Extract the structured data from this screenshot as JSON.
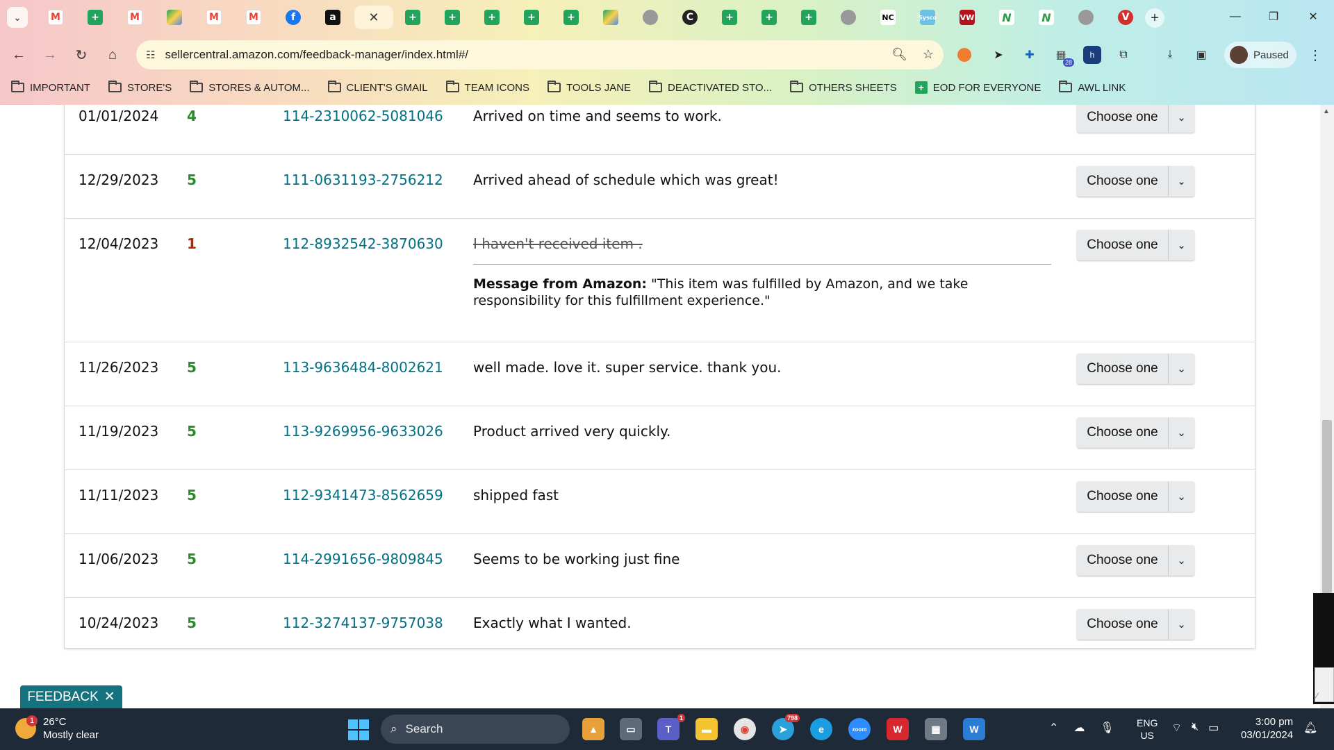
{
  "browser": {
    "url": "sellercentral.amazon.com/feedback-manager/index.html#/",
    "profile_label": "Paused",
    "bookmarks": [
      {
        "label": "IMPORTANT",
        "type": "folder"
      },
      {
        "label": "STORE'S",
        "type": "folder"
      },
      {
        "label": "STORES & AUTOM...",
        "type": "folder"
      },
      {
        "label": "CLIENT'S GMAIL",
        "type": "folder"
      },
      {
        "label": "TEAM ICONS",
        "type": "folder"
      },
      {
        "label": "TOOLS JANE",
        "type": "folder"
      },
      {
        "label": "DEACTIVATED STO...",
        "type": "folder"
      },
      {
        "label": "OTHERS SHEETS",
        "type": "folder"
      },
      {
        "label": "EOD FOR EVERYONE",
        "type": "sheet"
      },
      {
        "label": "AWL LINK",
        "type": "folder"
      }
    ],
    "tab_icons": [
      "gmail",
      "sheets",
      "gmail",
      "drive",
      "gmail",
      "gmail",
      "facebook",
      "amazon",
      "active-close",
      "sheets",
      "sheets",
      "sheets",
      "sheets",
      "sheets",
      "tool",
      "generic",
      "dark-c",
      "sheets",
      "sheets",
      "sheets",
      "cloud",
      "nc",
      "sysco",
      "vw",
      "n",
      "n",
      "circle",
      "red-v"
    ],
    "extension_badge": "28"
  },
  "feedback": {
    "rows": [
      {
        "date": "01/01/2024",
        "rating": "4",
        "order": "114-2310062-5081046",
        "comment": "Arrived on time and seems to work.",
        "action": "Choose one"
      },
      {
        "date": "12/29/2023",
        "rating": "5",
        "order": "111-0631193-2756212",
        "comment": "Arrived ahead of schedule which was great!",
        "action": "Choose one"
      },
      {
        "date": "12/04/2023",
        "rating": "1",
        "order": "112-8932542-3870630",
        "comment": "I haven't received item .",
        "struck": true,
        "amazon_label": "Message from Amazon:",
        "amazon_message": "\"This item was fulfilled by Amazon, and we take responsibility for this fulfillment experience.\"",
        "action": "Choose one"
      },
      {
        "date": "11/26/2023",
        "rating": "5",
        "order": "113-9636484-8002621",
        "comment": "well made. love it. super service. thank you.",
        "action": "Choose one"
      },
      {
        "date": "11/19/2023",
        "rating": "5",
        "order": "113-9269956-9633026",
        "comment": "Product arrived very quickly.",
        "action": "Choose one"
      },
      {
        "date": "11/11/2023",
        "rating": "5",
        "order": "112-9341473-8562659",
        "comment": "shipped fast",
        "action": "Choose one"
      },
      {
        "date": "11/06/2023",
        "rating": "5",
        "order": "114-2991656-9809845",
        "comment": "Seems to be working just fine",
        "action": "Choose one"
      },
      {
        "date": "10/24/2023",
        "rating": "5",
        "order": "112-3274137-9757038",
        "comment": "Exactly what I wanted.",
        "action": "Choose one"
      }
    ],
    "feedback_tab_label": "FEEDBACK",
    "colors": {
      "link": "#007185",
      "positive": "#2a8a2a",
      "negative": "#b12704",
      "feedback_tab": "#14737f"
    }
  },
  "taskbar": {
    "weather_temp": "26°C",
    "weather_desc": "Mostly clear",
    "weather_badge": "1",
    "search_placeholder": "Search",
    "lang_primary": "ENG",
    "lang_secondary": "US",
    "time": "3:00 pm",
    "date": "03/01/2024",
    "telegram_badge": "798",
    "teams_badge": "1"
  }
}
